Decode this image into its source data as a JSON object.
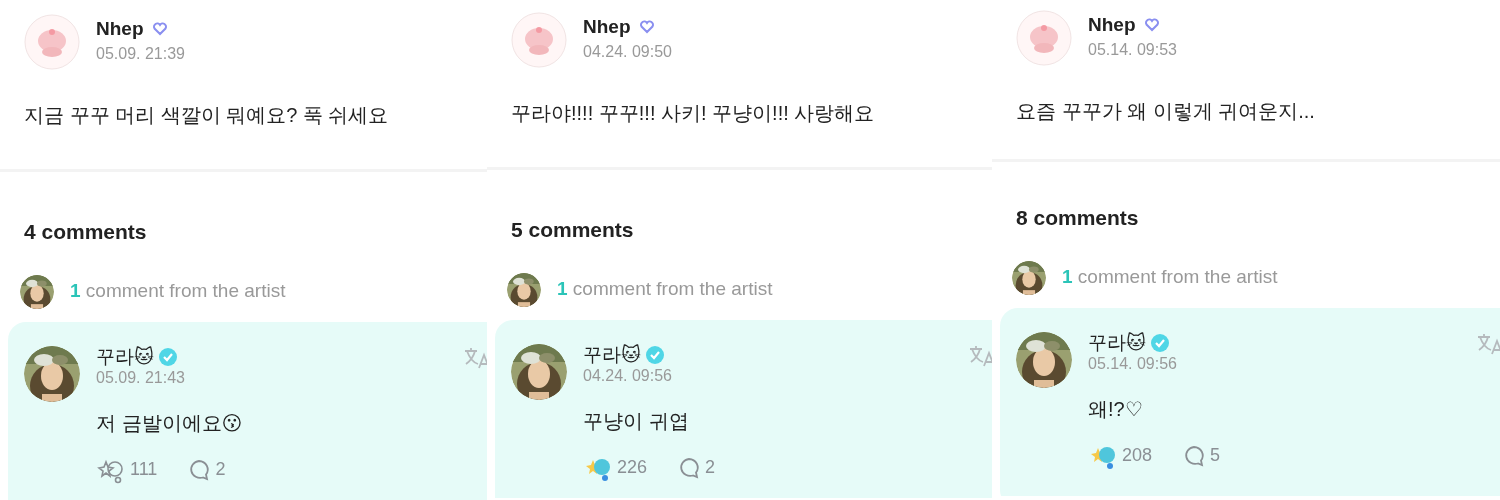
{
  "panels": [
    {
      "author": {
        "name": "Nhep",
        "time": "05.09. 21:39"
      },
      "text": "지금 꾸꾸 머리 색깔이 뭐예요? 푹 쉬세요",
      "comment_count": "4 comments",
      "artist_summary": {
        "count": "1",
        "label": "comment from the artist"
      },
      "artist_comment": {
        "name": "꾸라🐱",
        "time": "05.09. 21:43",
        "text": "저 금발이에요😗",
        "liked": false,
        "likes": "111",
        "replies": "2"
      }
    },
    {
      "author": {
        "name": "Nhep",
        "time": "04.24. 09:50"
      },
      "text": "꾸라야!!!! 꾸꾸!!! 사키! 꾸냥이!!! 사랑해요",
      "comment_count": "5 comments",
      "artist_summary": {
        "count": "1",
        "label": "comment from the artist"
      },
      "artist_comment": {
        "name": "꾸라🐱",
        "time": "04.24. 09:56",
        "text": "꾸냥이 귀엽",
        "liked": true,
        "likes": "226",
        "replies": "2"
      }
    },
    {
      "author": {
        "name": "Nhep",
        "time": "05.14. 09:53"
      },
      "text": "요즘 꾸꾸가 왜 이렇게 귀여운지...",
      "comment_count": "8 comments",
      "artist_summary": {
        "count": "1",
        "label": "comment from the artist"
      },
      "artist_comment": {
        "name": "꾸라🐱",
        "time": "05.14. 09:56",
        "text": "왜!?♡",
        "liked": true,
        "likes": "208",
        "replies": "5"
      }
    }
  ]
}
